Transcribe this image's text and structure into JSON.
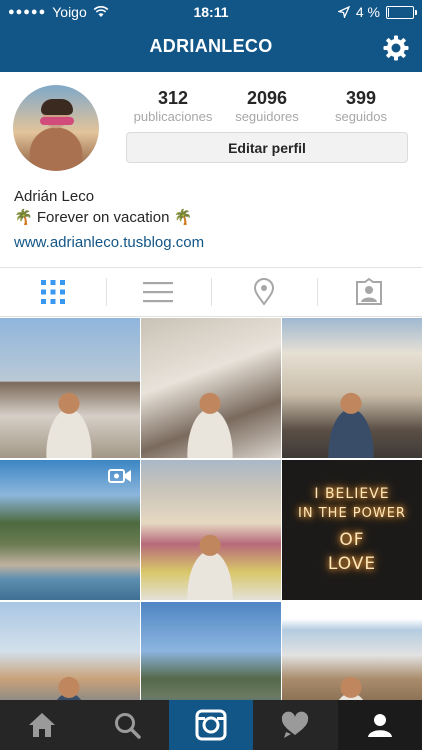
{
  "status_bar": {
    "carrier": "Yoigo",
    "time": "18:11",
    "battery": "4 %",
    "battery_level": 0.04
  },
  "header": {
    "username": "ADRIANLECO",
    "icons": [
      "gear-icon"
    ]
  },
  "profile": {
    "stats": [
      {
        "value": "312",
        "label": "publicaciones"
      },
      {
        "value": "2096",
        "label": "seguidores"
      },
      {
        "value": "399",
        "label": "seguidos"
      }
    ],
    "edit_button": "Editar perfil",
    "name": "Adrián Leco",
    "bio": "🌴 Forever on vacation 🌴",
    "website": "www.adrianleco.tusblog.com"
  },
  "tabs": [
    {
      "icon": "grid-icon",
      "active": true
    },
    {
      "icon": "list-icon",
      "active": false
    },
    {
      "icon": "location-pin-icon",
      "active": false
    },
    {
      "icon": "tagged-photos-icon",
      "active": false
    }
  ],
  "grid": {
    "neon_lines": [
      "I BELIEVE",
      "IN THE POWER",
      "OF",
      "LOVE"
    ],
    "video_badge_icon": "video-camera-icon"
  },
  "bottom_nav": [
    {
      "icon": "home-icon"
    },
    {
      "icon": "search-icon"
    },
    {
      "icon": "camera-icon",
      "active": true
    },
    {
      "icon": "activity-heart-icon"
    },
    {
      "icon": "profile-icon",
      "active": true
    }
  ],
  "colors": {
    "brand_blue": "#125688",
    "link_blue": "#125688",
    "active_tab": "#3897f0",
    "bottom_nav_bg": "#262626"
  }
}
